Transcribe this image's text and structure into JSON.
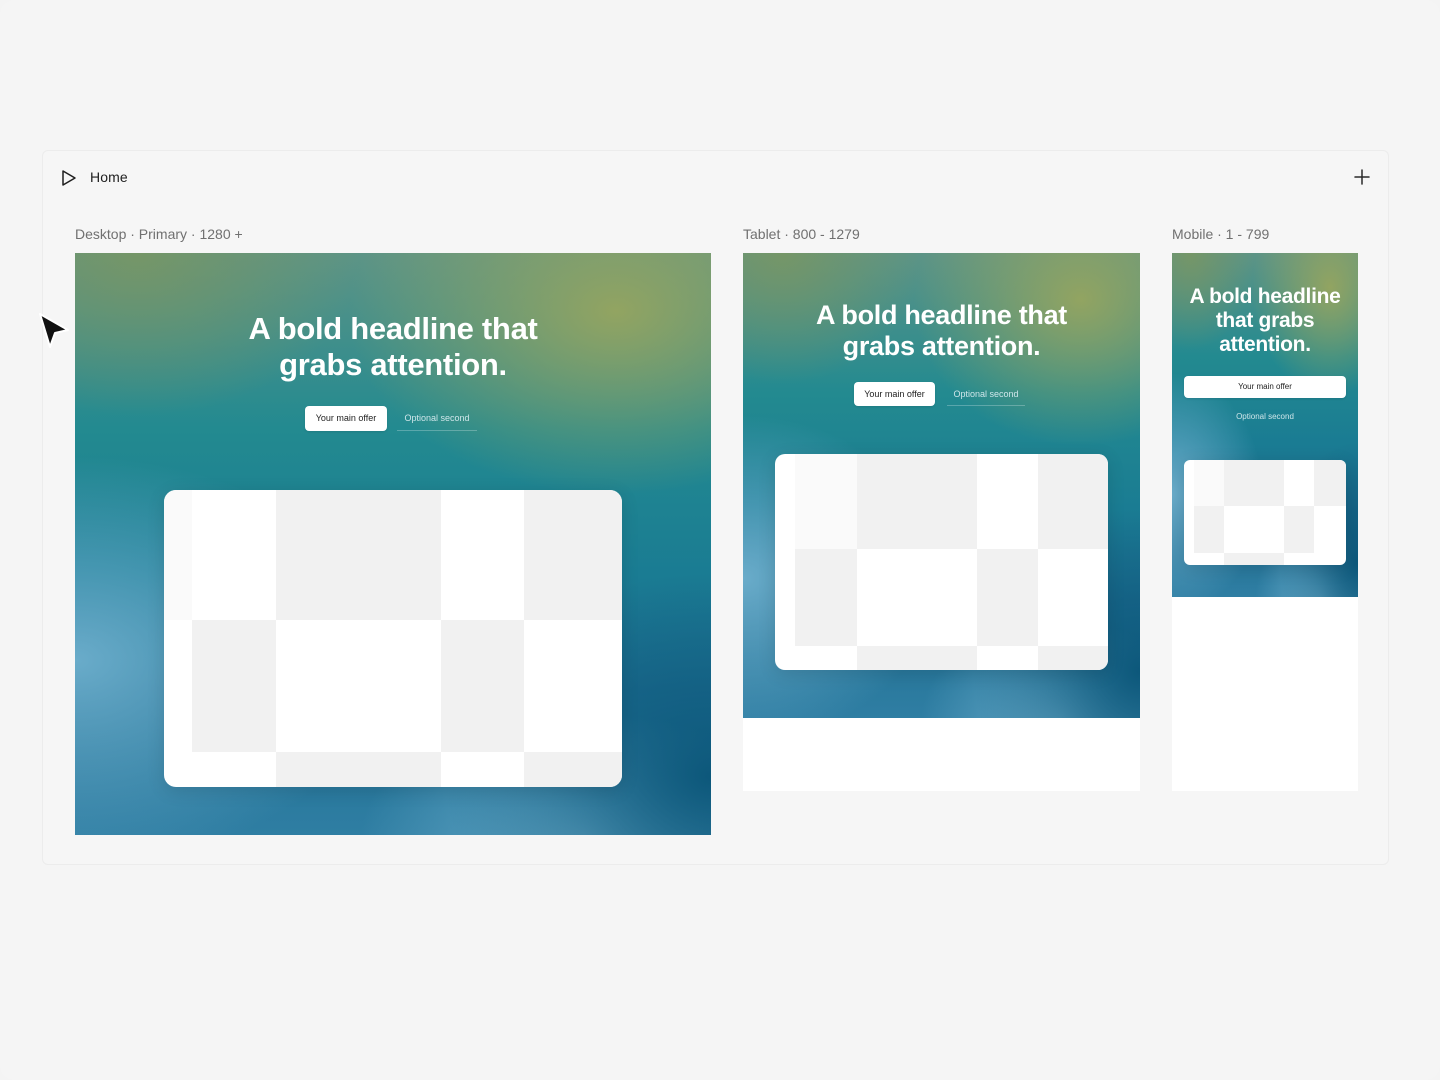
{
  "page": {
    "name": "Home",
    "add_icon": "plus-icon",
    "page_icon": "play-icon"
  },
  "breakpoints": [
    {
      "label": "Desktop · Primary · 1280 +",
      "headline": "A bold headline that grabs attention.",
      "primary_cta": "Your main offer",
      "secondary_cta": "Optional second"
    },
    {
      "label": "Tablet · 800 - 1279",
      "headline": "A bold headline that grabs attention.",
      "primary_cta": "Your main offer",
      "secondary_cta": "Optional second"
    },
    {
      "label": "Mobile · 1 - 799",
      "headline": "A bold headline that grabs attention.",
      "primary_cta": "Your main offer",
      "secondary_cta": "Optional second"
    }
  ],
  "colors": {
    "background": "#f5f5f5",
    "label": "#707070",
    "gradient_teal": "#238a90",
    "gradient_olive": "#96a55f",
    "gradient_blue": "#6eafcd",
    "gradient_deep": "#0a5578"
  }
}
